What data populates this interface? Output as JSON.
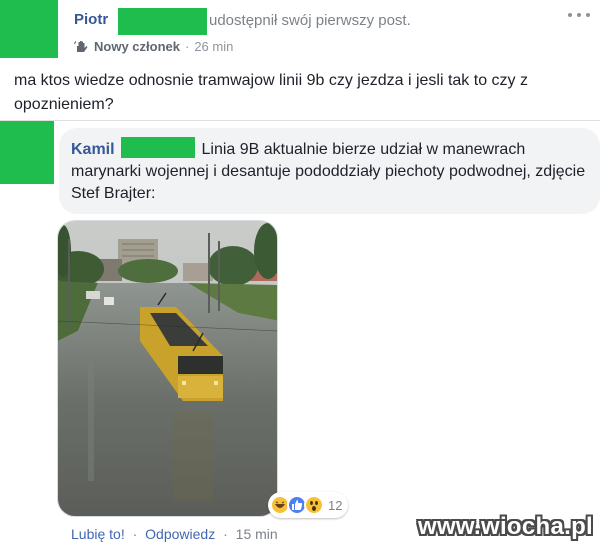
{
  "post": {
    "author": "Piotr",
    "action": "udostępnił swój pierwszy post.",
    "member_badge": "Nowy członek",
    "time": "26 min",
    "text": "ma ktos wiedze odnosnie tramwajow linii 9b czy jezdza i jesli tak to czy z opoznieniem?"
  },
  "comment": {
    "author": "Kamil",
    "text": "Linia 9B aktualnie bierze udział w manewrach marynarki wojennej i desantuje pododdziały piechoty podwodnej, zdjęcie Stef Brajter:",
    "reaction_count": "12",
    "reactions": [
      "haha-icon",
      "like-icon",
      "wow-icon"
    ],
    "like_label": "Lubię to!",
    "reply_label": "Odpowiedz",
    "time": "15 min"
  },
  "watermark": "www.wiocha.pl",
  "colors": {
    "redaction_green": "#1fbd4e",
    "link_blue": "#365899",
    "action_blue": "#4267b2",
    "bubble_gray": "#f2f3f5"
  }
}
